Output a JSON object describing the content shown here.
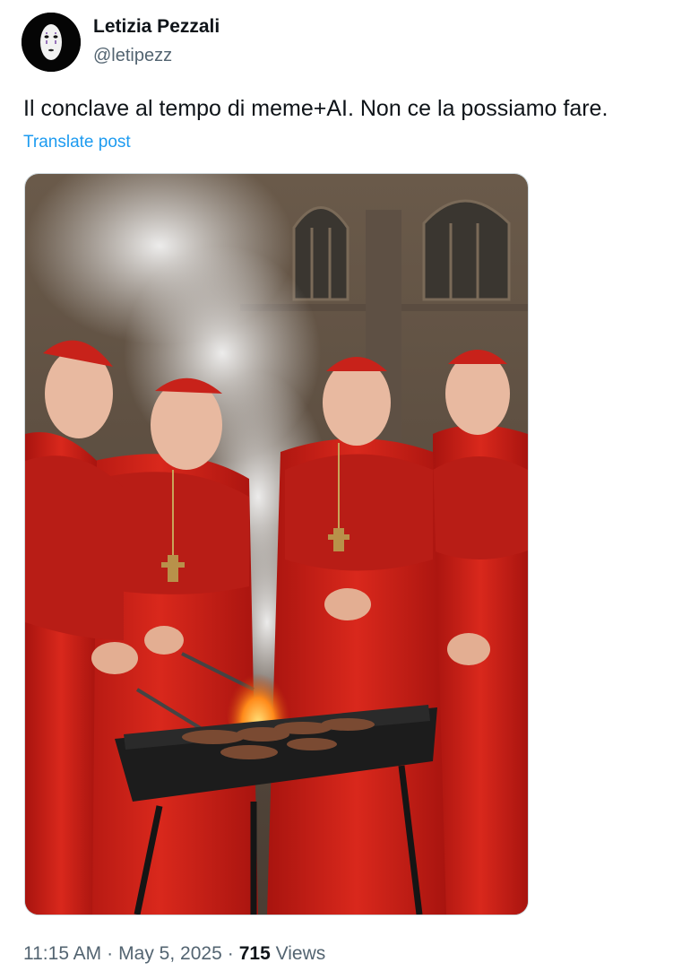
{
  "author": {
    "display_name": "Letizia Pezzali",
    "handle": "@letipezz"
  },
  "post": {
    "text": "Il conclave al tempo di meme+AI. Non ce la possiamo fare.",
    "translate_label": "Translate post"
  },
  "meta": {
    "time": "11:15 AM",
    "separator": "·",
    "date": "May 5, 2025",
    "views_count": "715",
    "views_label": "Views"
  },
  "colors": {
    "link": "#1d9bf0",
    "secondary_text": "#536471",
    "primary_text": "#0f1419",
    "robe_red": "#c8221a"
  },
  "icons": {
    "avatar": "no-face-mask-avatar"
  }
}
